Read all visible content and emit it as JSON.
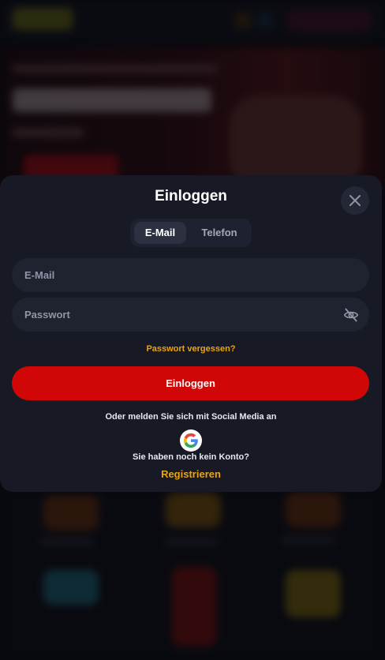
{
  "modal": {
    "title": "Einloggen",
    "tabs": [
      {
        "label": "E-Mail",
        "active": true
      },
      {
        "label": "Telefon",
        "active": false
      }
    ],
    "email_field": {
      "placeholder": "E-Mail",
      "value": ""
    },
    "password_field": {
      "placeholder": "Passwort",
      "value": ""
    },
    "forgot_password_label": "Passwort vergessen?",
    "login_button_label": "Einloggen",
    "social_prompt": "Oder melden Sie sich mit Social Media an",
    "no_account_text": "Sie haben noch kein Konto?",
    "register_label": "Registrieren"
  },
  "icons": {
    "close": "close-icon",
    "password_visibility": "eye-off-icon",
    "google": "google-icon"
  },
  "colors": {
    "accent": "#e8a313",
    "primary_button": "#d10606",
    "modal_background": "#171a24",
    "field_background": "#1f2330"
  }
}
